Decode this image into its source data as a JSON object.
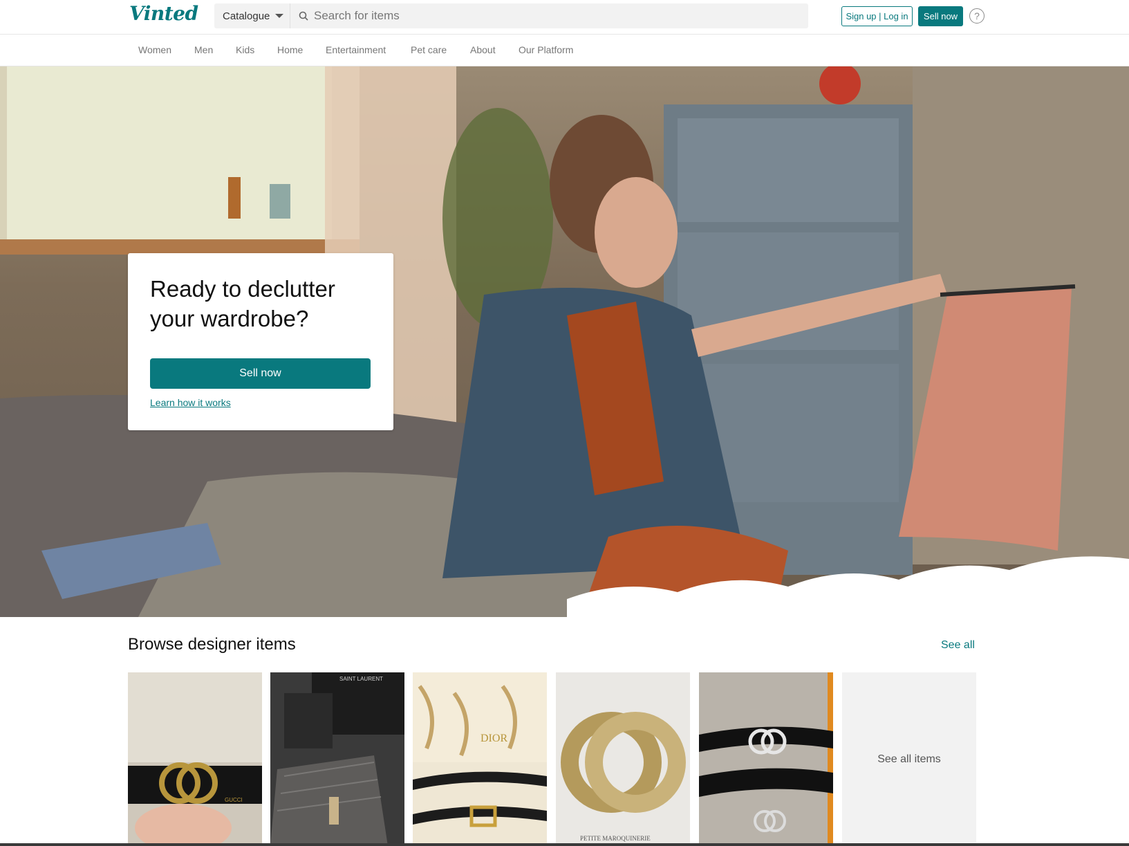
{
  "header": {
    "logo": "Vinted",
    "catalogue_label": "Catalogue",
    "search_placeholder": "Search for items",
    "signup_login_label": "Sign up | Log in",
    "sell_now_label": "Sell now",
    "help_glyph": "?"
  },
  "nav": {
    "items": [
      "Women",
      "Men",
      "Kids",
      "Home",
      "Entertainment",
      "Pet care",
      "About",
      "Our Platform"
    ]
  },
  "hero": {
    "title": "Ready to declutter your wardrobe?",
    "cta_label": "Sell now",
    "learn_link": "Learn how it works"
  },
  "browse": {
    "title": "Browse designer items",
    "see_all_label": "See all",
    "see_all_items_label": "See all items",
    "thumbnails": [
      {
        "name": "gucci-belt-image",
        "label_text": "GUCCI"
      },
      {
        "name": "ysl-bag-image",
        "label_text": "SAINT LAURENT"
      },
      {
        "name": "dior-belt-image",
        "label_text": "DIOR"
      },
      {
        "name": "chanel-brooch-image",
        "label_text": "PETITE MAROQUINERIE"
      },
      {
        "name": "chanel-belt-image",
        "label_text": ""
      }
    ]
  },
  "colors": {
    "brand": "#09797e",
    "search_bg": "#f2f2f2",
    "card_bg": "#ffffff"
  },
  "icons": {
    "search": "search-icon",
    "catalogue_caret": "chevron-down-icon",
    "help": "help-circle-icon"
  }
}
